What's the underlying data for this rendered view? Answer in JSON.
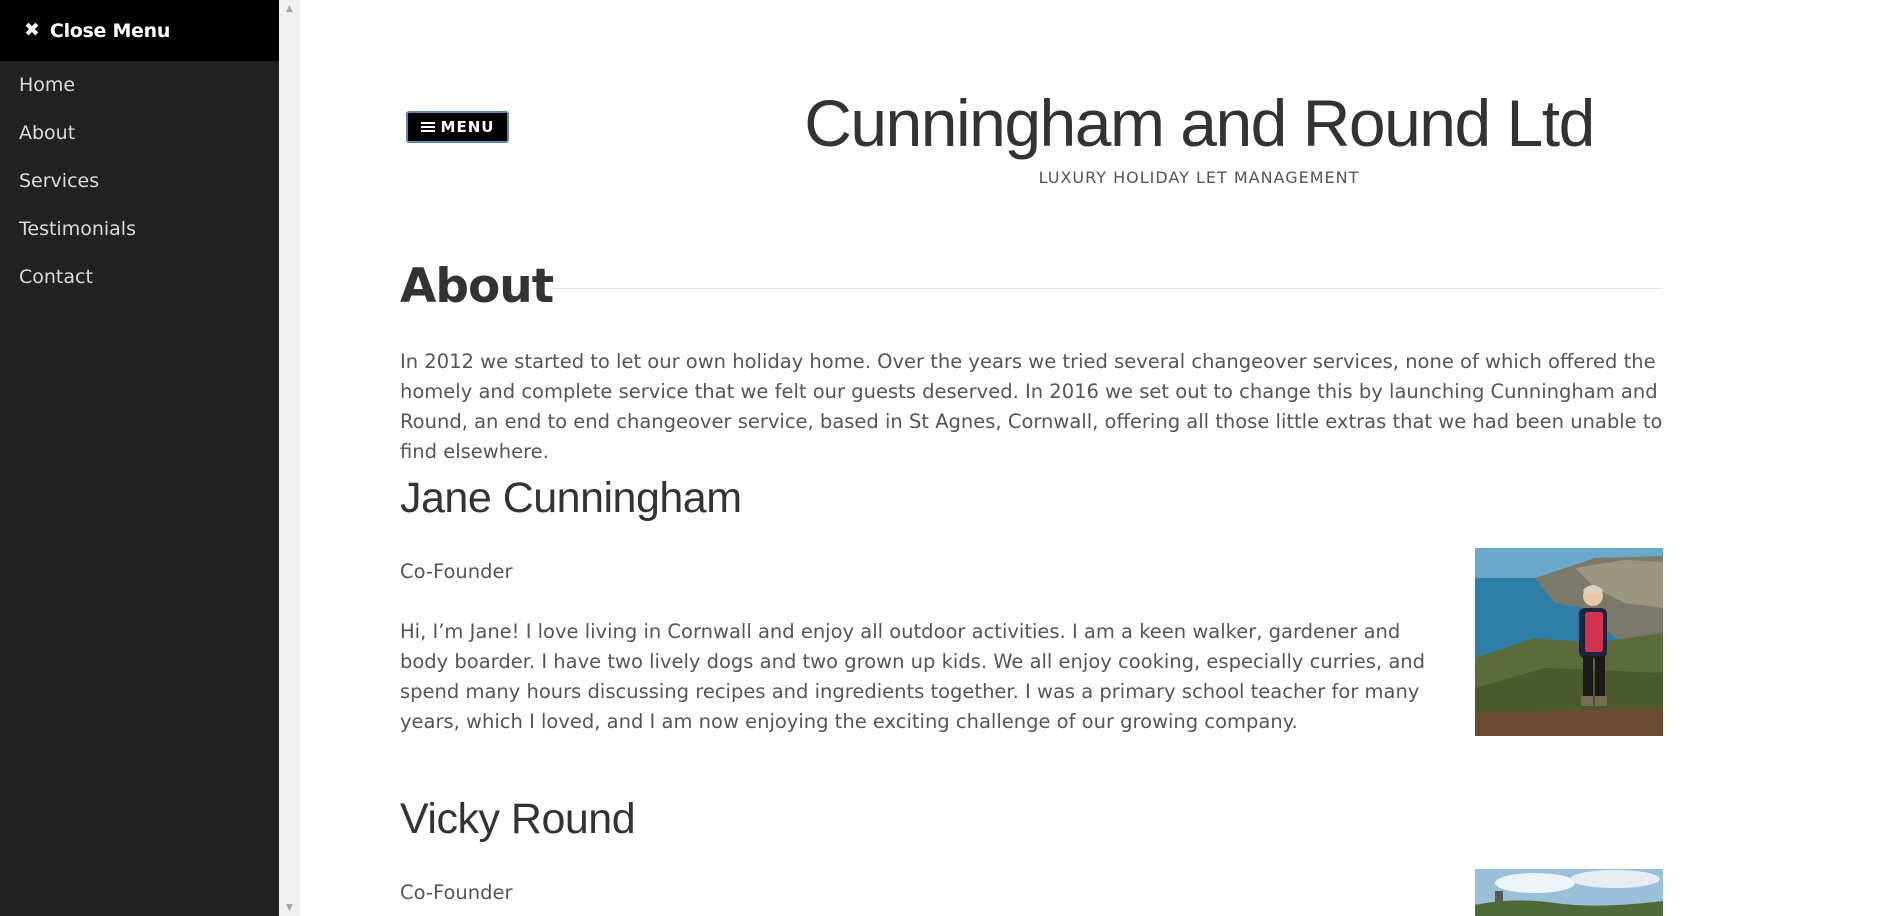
{
  "sidebar": {
    "close_icon": "close-icon",
    "close_label": "Close Menu",
    "items": [
      {
        "label": "Home"
      },
      {
        "label": "About"
      },
      {
        "label": "Services"
      },
      {
        "label": "Testimonials"
      },
      {
        "label": "Contact"
      }
    ]
  },
  "header": {
    "menu_icon": "hamburger-icon",
    "menu_label": "MENU",
    "title": "Cunningham and Round Ltd",
    "tagline": "LUXURY HOLIDAY LET MANAGEMENT"
  },
  "about": {
    "title": "About",
    "intro": "In 2012 we started to let our own holiday home. Over the years we tried several changeover services, none of which offered the homely and complete service that we felt our guests deserved. In 2016 we set out to change this by launching Cunningham and Round, an end to end changeover service, based in St Agnes, Cornwall, offering all those little extras that we had been unable to find elsewhere."
  },
  "people": [
    {
      "name": "Jane Cunningham",
      "role": "Co-Founder",
      "bio": "Hi, I’m Jane! I love living in Cornwall and enjoy all outdoor activities. I am a keen walker, gardener and body boarder. I have two lively dogs and two grown up kids. We all enjoy cooking, especially curries, and spend many hours discussing recipes and ingredients together. I was a primary school teacher for many years, which I loved, and I am now enjoying the exciting challenge of our growing company."
    },
    {
      "name": "Vicky Round",
      "role": "Co-Founder"
    }
  ],
  "colors": {
    "sidebar_bg": "#222222",
    "close_bar_bg": "#000000",
    "menu_button_border": "#5b88b4",
    "heading": "#333333",
    "body_text": "#555555"
  }
}
